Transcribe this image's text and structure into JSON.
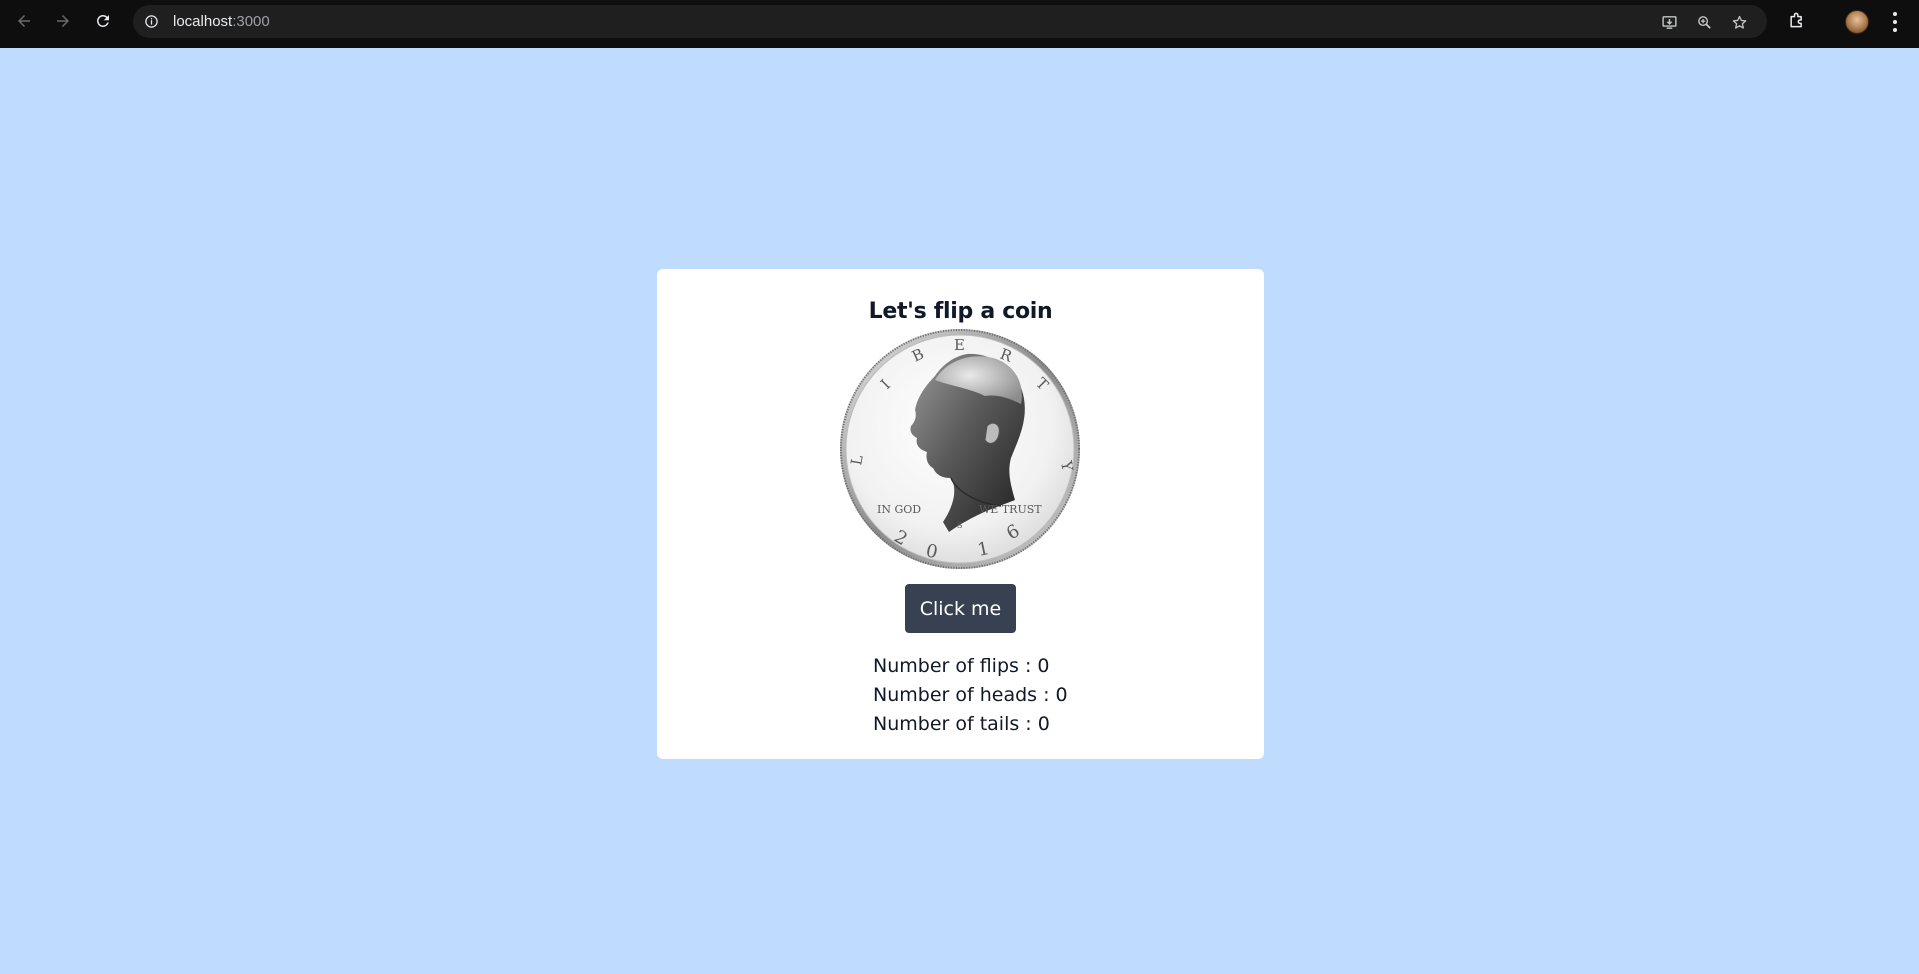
{
  "browser": {
    "url_host": "localhost",
    "url_port": ":3000",
    "icons": [
      "back-arrow-icon",
      "forward-arrow-icon",
      "reload-icon",
      "site-info-icon",
      "install-app-icon",
      "zoom-icon",
      "bookmark-star-icon",
      "extensions-icon",
      "profile-avatar",
      "more-menu-icon"
    ]
  },
  "page": {
    "background": "#bfdbfe",
    "title": "Let's flip a coin",
    "button_label": "Click me",
    "button_color": "#374151",
    "stats": {
      "flips": "Number of flips : 0",
      "heads": "Number of heads : 0",
      "tails": "Number of tails : 0"
    },
    "coin": {
      "top_letters": [
        "L",
        "I",
        "B",
        "E",
        "R",
        "T",
        "Y"
      ],
      "motto_left": "IN GOD",
      "motto_right": "WE TRUST",
      "mint_mark": "S",
      "year_digits": [
        "2",
        "0",
        "1",
        "6"
      ]
    }
  }
}
